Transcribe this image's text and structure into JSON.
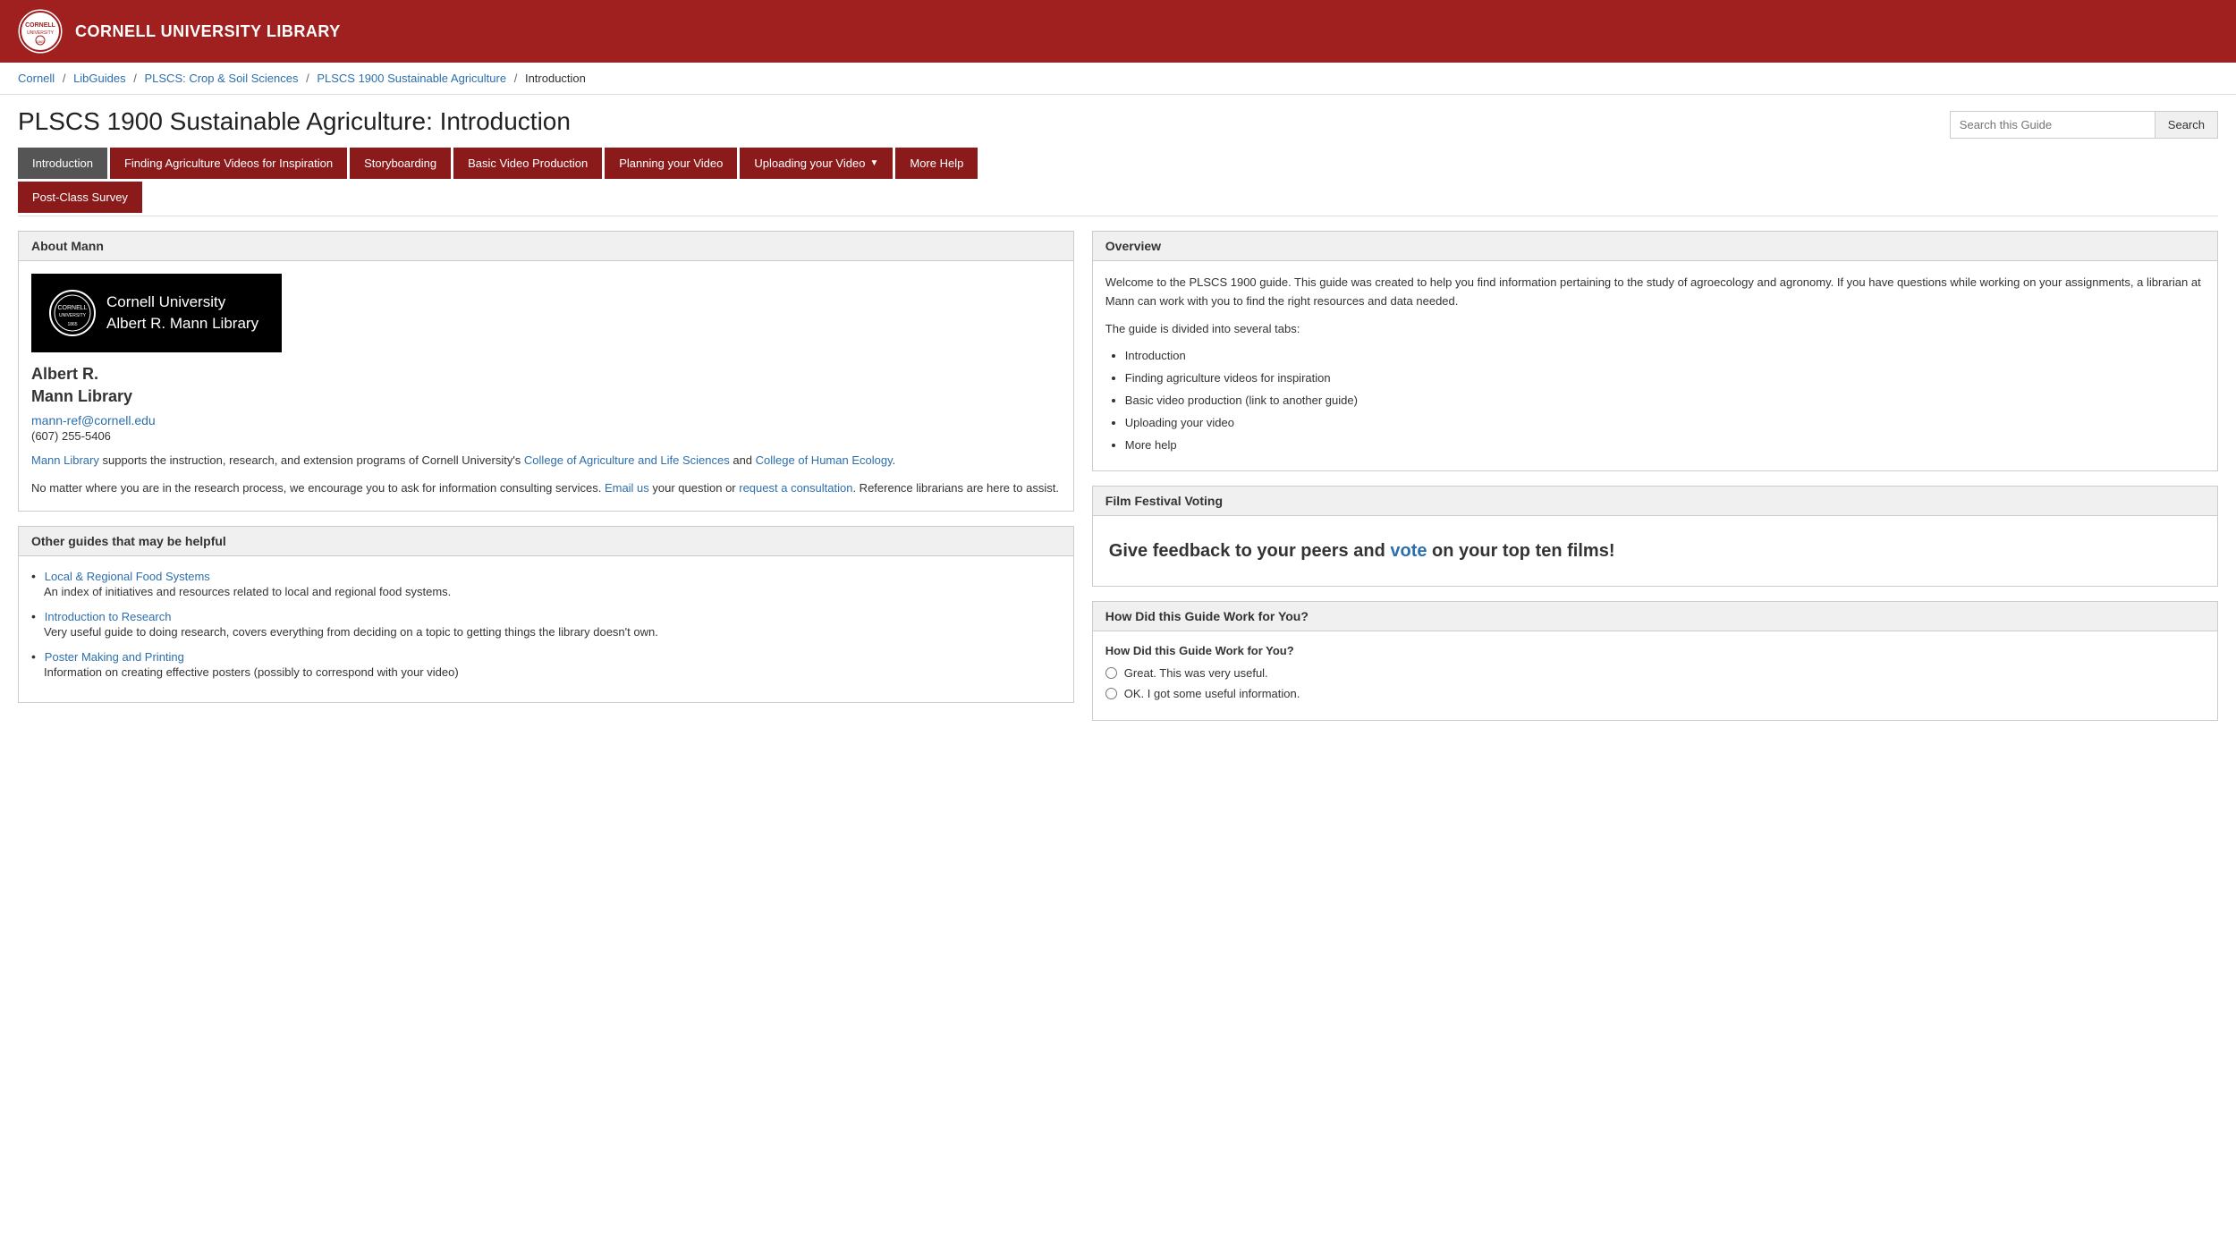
{
  "header": {
    "logo_alt": "Cornell University seal",
    "title": "CORNELL UNIVERSITY LIBRARY"
  },
  "breadcrumb": {
    "items": [
      {
        "label": "Cornell",
        "href": "#"
      },
      {
        "label": "LibGuides",
        "href": "#"
      },
      {
        "label": "PLSCS: Crop & Soil Sciences",
        "href": "#"
      },
      {
        "label": "PLSCS 1900 Sustainable Agriculture",
        "href": "#"
      },
      {
        "label": "Introduction",
        "href": null
      }
    ]
  },
  "page": {
    "title": "PLSCS 1900 Sustainable Agriculture: Introduction"
  },
  "search": {
    "placeholder": "Search this Guide",
    "button_label": "Search"
  },
  "nav": {
    "tabs": [
      {
        "label": "Introduction",
        "active": true,
        "dropdown": false
      },
      {
        "label": "Finding Agriculture Videos for Inspiration",
        "active": false,
        "dropdown": false
      },
      {
        "label": "Storyboarding",
        "active": false,
        "dropdown": false
      },
      {
        "label": "Basic Video Production",
        "active": false,
        "dropdown": false
      },
      {
        "label": "Planning your Video",
        "active": false,
        "dropdown": false
      },
      {
        "label": "Uploading your Video",
        "active": false,
        "dropdown": true
      },
      {
        "label": "More Help",
        "active": false,
        "dropdown": false
      }
    ],
    "second_row": [
      {
        "label": "Post-Class Survey",
        "active": false,
        "dropdown": false
      }
    ]
  },
  "left_col": {
    "about_mann": {
      "header": "About Mann",
      "image_line1": "Cornell University",
      "image_line2": "Albert R. Mann Library",
      "name": "Albert R.",
      "library": "Mann Library",
      "email": "mann-ref@cornell.edu",
      "phone": "(607) 255-5406",
      "description_parts": [
        {
          "text": "Mann Library",
          "link": true
        },
        {
          "text": " supports the instruction, research, and extension programs of Cornell University's ",
          "link": false
        },
        {
          "text": "College of Agriculture and Life Sciences",
          "link": true
        },
        {
          "text": " and ",
          "link": false
        },
        {
          "text": "College of Human Ecology",
          "link": true
        },
        {
          "text": ".",
          "link": false
        }
      ],
      "description2_parts": [
        {
          "text": "No matter where you are in the research process, we encourage you to ask for information consulting services. ",
          "link": false
        },
        {
          "text": "Email us",
          "link": true
        },
        {
          "text": " your question or ",
          "link": false
        },
        {
          "text": "request a consultation",
          "link": true
        },
        {
          "text": ". Reference librarians are here to assist.",
          "link": false
        }
      ]
    },
    "other_guides": {
      "header": "Other guides that may be helpful",
      "guides": [
        {
          "label": "Local & Regional Food Systems",
          "description": "An index of initiatives and resources related to local and regional food systems."
        },
        {
          "label": "Introduction to Research",
          "description": "Very useful guide to doing research, covers everything from deciding on a topic to getting things the library doesn't own."
        },
        {
          "label": "Poster Making and Printing",
          "description": "Information on creating effective posters (possibly to correspond with your video)"
        }
      ]
    }
  },
  "right_col": {
    "overview": {
      "header": "Overview",
      "intro": "Welcome to the PLSCS 1900 guide.  This guide was created to help you find information pertaining to the study of agroecology and agronomy.  If you have questions while working on your assignments, a librarian at Mann can work with you to find the right resources and data needed.",
      "tabs_label": "The guide is divided into several tabs:",
      "tab_list": [
        "Introduction",
        "Finding agriculture videos for inspiration",
        "Basic video production (link to another guide)",
        "Uploading your video",
        "More help"
      ]
    },
    "film_festival": {
      "header": "Film Festival Voting",
      "text_before": "Give feedback to your peers and ",
      "vote_label": "vote",
      "text_after": " on your top ten films!"
    },
    "survey": {
      "header": "How Did this Guide Work for You?",
      "sub_header": "How Did this Guide Work for You?",
      "options": [
        "Great. This was very useful.",
        "OK. I got some useful information."
      ]
    }
  }
}
